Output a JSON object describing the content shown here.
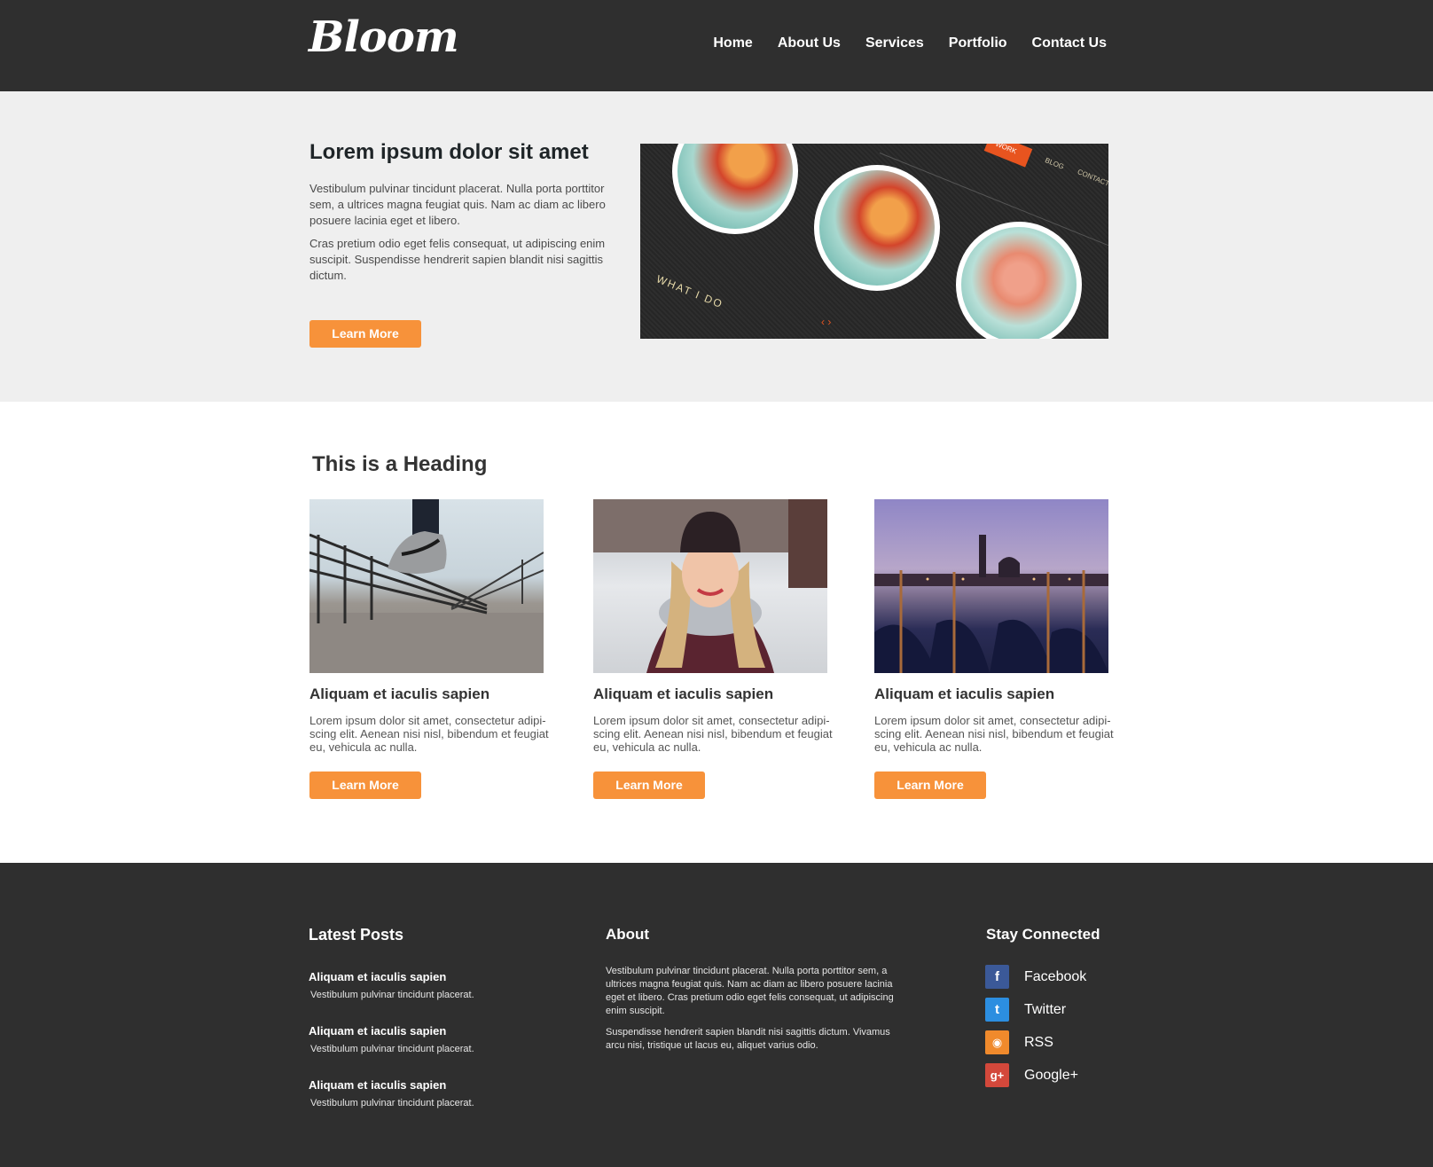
{
  "brand": {
    "logo": "Bloom"
  },
  "nav": {
    "items": [
      "Home",
      "About Us",
      "Services",
      "Portfolio",
      "Contact Us"
    ]
  },
  "hero": {
    "title": "Lorem ipsum dolor sit amet",
    "p1": "Vestibulum pulvinar tincidunt placerat. Nulla porta porttitor sem, a ultrices magna feugiat quis. Nam ac diam ac libero posuere lacinia eget et libero.",
    "p2": "Cras pretium odio eget felis consequat, ut adipiscing enim suscipit. Suspendisse hendrerit sapien blandit nisi sagittis dictum.",
    "button": "Learn More",
    "image": {
      "tag": "WORK",
      "blog": "BLOG",
      "contact": "CONTACT",
      "caption": "WHAT I DO",
      "arrows": "‹ ›"
    }
  },
  "section": {
    "heading": "This is a Heading",
    "cards": [
      {
        "title": "Aliquam et iaculis sapien",
        "text": "Lorem ipsum dolor sit amet, consectetur adipi-scing elit. Aenean nisi nisl, bibendum et feugiat eu, vehicula ac nulla.",
        "button": "Learn More",
        "image": "sneaker-photo"
      },
      {
        "title": "Aliquam et iaculis sapien",
        "text": "Lorem ipsum dolor sit amet, consectetur adipi-scing elit. Aenean nisi nisl, bibendum et feugiat eu, vehicula ac nulla.",
        "button": "Learn More",
        "image": "woman-winter-photo"
      },
      {
        "title": "Aliquam et iaculis sapien",
        "text": "Lorem ipsum dolor sit amet, consectetur adipi-scing elit. Aenean nisi nisl, bibendum et feugiat eu, vehicula ac nulla.",
        "button": "Learn More",
        "image": "venice-gondolas-photo"
      }
    ]
  },
  "footer": {
    "latest": {
      "heading": "Latest Posts",
      "posts": [
        {
          "title": "Aliquam et iaculis sapien",
          "text": "Vestibulum pulvinar tincidunt placerat."
        },
        {
          "title": "Aliquam et iaculis sapien",
          "text": "Vestibulum pulvinar tincidunt placerat."
        },
        {
          "title": "Aliquam et iaculis sapien",
          "text": "Vestibulum pulvinar tincidunt placerat."
        }
      ]
    },
    "about": {
      "heading": "About",
      "p1": "Vestibulum pulvinar tincidunt placerat. Nulla porta porttitor sem, a ultrices magna feugiat quis. Nam ac diam ac libero posuere lacinia eget et libero. Cras pretium odio eget felis consequat, ut adipiscing enim suscipit.",
      "p2": "Suspendisse hendrerit sapien blandit nisi sagittis dictum. Vivamus arcu nisi, tristique ut lacus eu, aliquet varius odio."
    },
    "social": {
      "heading": "Stay Connected",
      "items": [
        {
          "label": "Facebook",
          "icon": "facebook-icon",
          "glyph": "f",
          "color": "#3b5998"
        },
        {
          "label": "Twitter",
          "icon": "twitter-icon",
          "glyph": "t",
          "color": "#2c8ee0"
        },
        {
          "label": "RSS",
          "icon": "rss-icon",
          "glyph": "◉",
          "color": "#f08a2c"
        },
        {
          "label": "Google+",
          "icon": "google-plus-icon",
          "glyph": "g+",
          "color": "#d3483b"
        }
      ]
    }
  },
  "colors": {
    "accent": "#f7923a",
    "dark": "#2f2f2f",
    "hero_bg": "#efefef"
  }
}
